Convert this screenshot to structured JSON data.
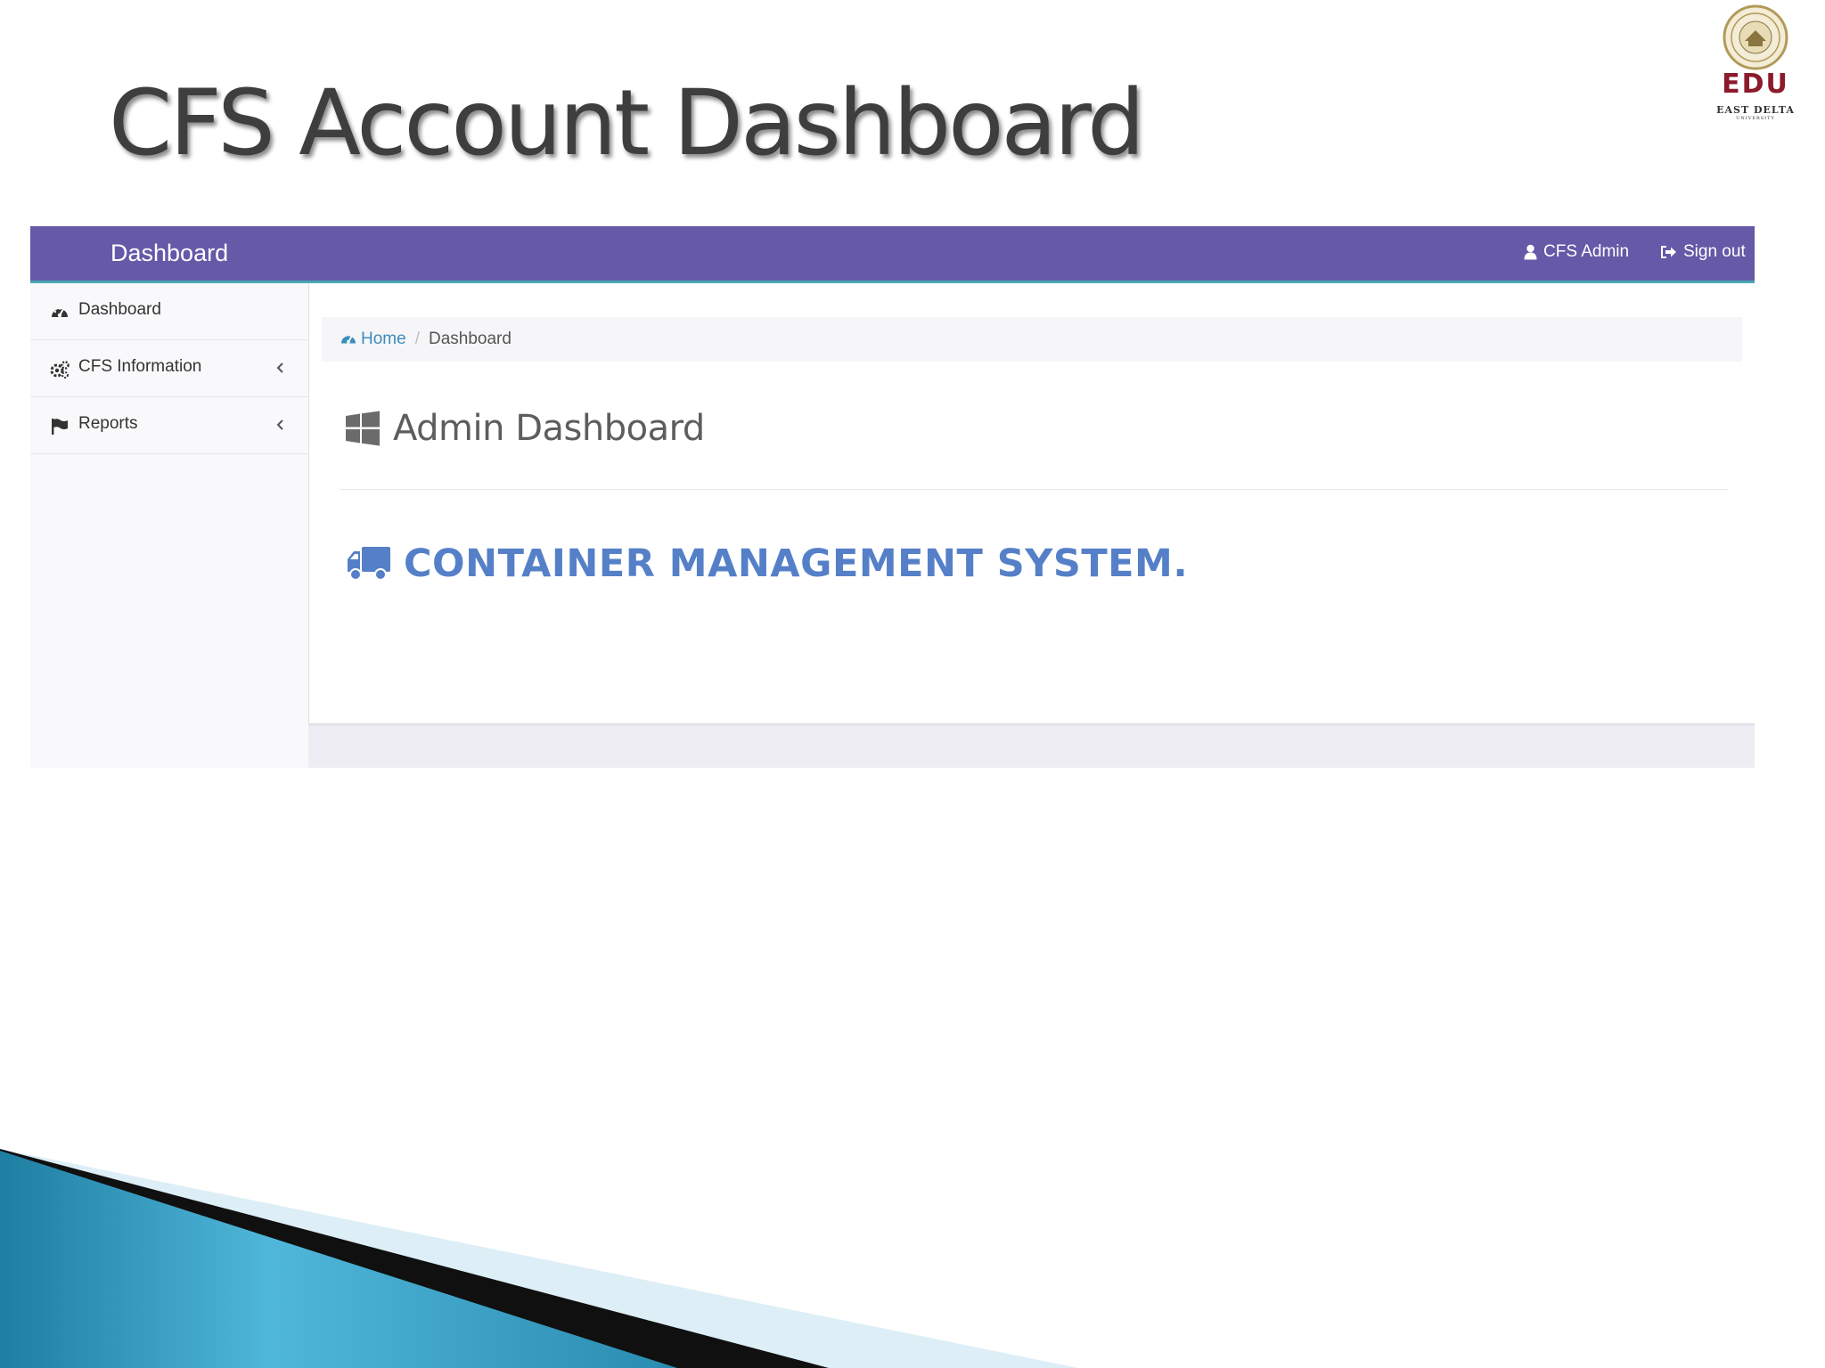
{
  "slide": {
    "title": "CFS Account Dashboard",
    "logo_text": "EDU",
    "logo_subtext": "EAST DELTA",
    "logo_subtext2": "UNIVERSITY"
  },
  "topbar": {
    "brand": "Dashboard",
    "user_label": "CFS Admin",
    "signout_label": "Sign out",
    "user_icon": "user-icon",
    "signout_icon": "sign-out-icon"
  },
  "sidebar": {
    "items": [
      {
        "label": "Dashboard",
        "icon": "dashboard-icon"
      },
      {
        "label": "CFS Information",
        "icon": "gears-icon",
        "has_submenu": true
      },
      {
        "label": "Reports",
        "icon": "flag-icon",
        "has_submenu": true
      }
    ]
  },
  "breadcrumb": {
    "home": "Home",
    "separator": "/",
    "current": "Dashboard"
  },
  "main": {
    "page_title": "Admin Dashboard",
    "page_icon": "windows-icon",
    "system_title": "CONTAINER MANAGEMENT SYSTEM.",
    "system_icon": "truck-icon"
  },
  "colors": {
    "topbar": "#6559a8",
    "topbar_accent": "#48a8b3",
    "link": "#3c8dbc",
    "system_title": "#5580c8",
    "logo_red": "#8b1a2b"
  }
}
